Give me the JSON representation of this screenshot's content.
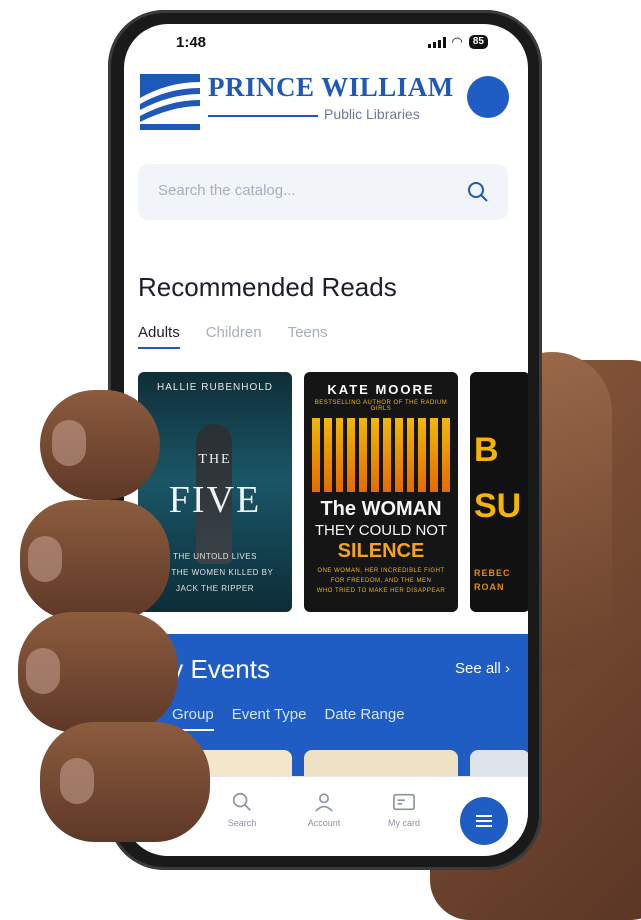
{
  "status_bar": {
    "time": "1:48",
    "battery": "85"
  },
  "header": {
    "logo_title": "PRINCE WILLIAM",
    "logo_subtitle": "Public Libraries",
    "accent_color": "#1f5dc4"
  },
  "search": {
    "placeholder": "Search the catalog..."
  },
  "recommended": {
    "title": "Recommended Reads",
    "tabs": [
      {
        "label": "Adults",
        "active": true
      },
      {
        "label": "Children",
        "active": false
      },
      {
        "label": "Teens",
        "active": false
      }
    ],
    "books": [
      {
        "author": "HALLIE RUBENHOLD",
        "title_top": "THE",
        "title_big": "FIVE",
        "subtitle_1": "THE UNTOLD LIVES",
        "subtitle_2": "OF THE WOMEN KILLED BY",
        "subtitle_3": "JACK THE RIPPER"
      },
      {
        "author": "KATE MOORE",
        "tagline": "BESTSELLING AUTHOR OF THE RADIUM GIRLS",
        "title_1": "The WOMAN",
        "title_2": "THEY COULD NOT",
        "title_3": "SILENCE",
        "blurb_1": "ONE WOMAN, HER INCREDIBLE FIGHT",
        "blurb_2": "FOR FREEDOM, AND THE MEN",
        "blurb_3": "WHO TRIED TO MAKE HER DISAPPEAR"
      },
      {
        "line_1": "B",
        "line_2": "SU",
        "author_1": "REBEC",
        "author_2": "ROAN"
      }
    ]
  },
  "events": {
    "title": "brary Events",
    "see_all": "See all ›",
    "tabs": [
      {
        "label": "Group",
        "active": true
      },
      {
        "label": "Event Type",
        "active": false
      },
      {
        "label": "Date Range",
        "active": false
      }
    ]
  },
  "bottom_nav": {
    "items": [
      {
        "label": "Search",
        "icon": "search-icon"
      },
      {
        "label": "Account",
        "icon": "account-icon"
      },
      {
        "label": "My card",
        "icon": "card-icon"
      }
    ],
    "menu_icon": "menu-icon"
  }
}
